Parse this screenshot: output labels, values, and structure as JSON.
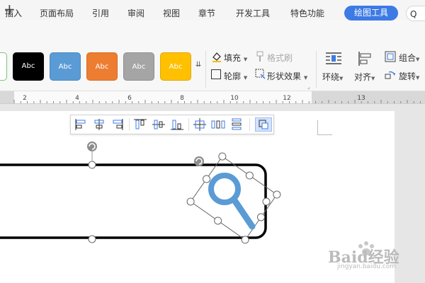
{
  "titlebar": {
    "new_tab": "+"
  },
  "menu": {
    "items": [
      "插入",
      "页面布局",
      "引用",
      "审阅",
      "视图",
      "章节",
      "开发工具",
      "特色功能"
    ],
    "active_tab": "绘图工具",
    "search": "Q"
  },
  "ribbon": {
    "shape_styles": [
      {
        "label": "Abc",
        "bg": "#000000",
        "fg": "#ffffff"
      },
      {
        "label": "Abc",
        "bg": "#5b9bd5",
        "fg": "#ffffff"
      },
      {
        "label": "Abc",
        "bg": "#ed7d31",
        "fg": "#ffffff"
      },
      {
        "label": "Abc",
        "bg": "#a5a5a5",
        "fg": "#ffffff"
      },
      {
        "label": "Abc",
        "bg": "#ffc000",
        "fg": "#ffffff"
      }
    ],
    "fill": "填充",
    "format_painter": "格式刷",
    "outline": "轮廓",
    "shape_effects": "形状效果",
    "wrap": "环绕",
    "align": "对齐",
    "group": "组合",
    "rotate": "旋转"
  },
  "ruler": {
    "labels": [
      "2",
      "4",
      "6",
      "8",
      "10",
      "12",
      "13"
    ]
  },
  "colors": {
    "accent": "#3d7ae5",
    "shape_outline": "#000000",
    "magnifier": "#5b9bd5"
  },
  "align_bar": {
    "icons": [
      "align-left-icon",
      "align-center-icon",
      "align-right-icon",
      "align-top-icon",
      "align-middle-icon",
      "align-bottom-icon",
      "align-center-both-icon",
      "distribute-horizontal-icon",
      "distribute-vertical-icon",
      "select-objects-icon"
    ]
  },
  "watermark": {
    "text": "Baid经验",
    "url": "jingyan.baidu.com"
  }
}
